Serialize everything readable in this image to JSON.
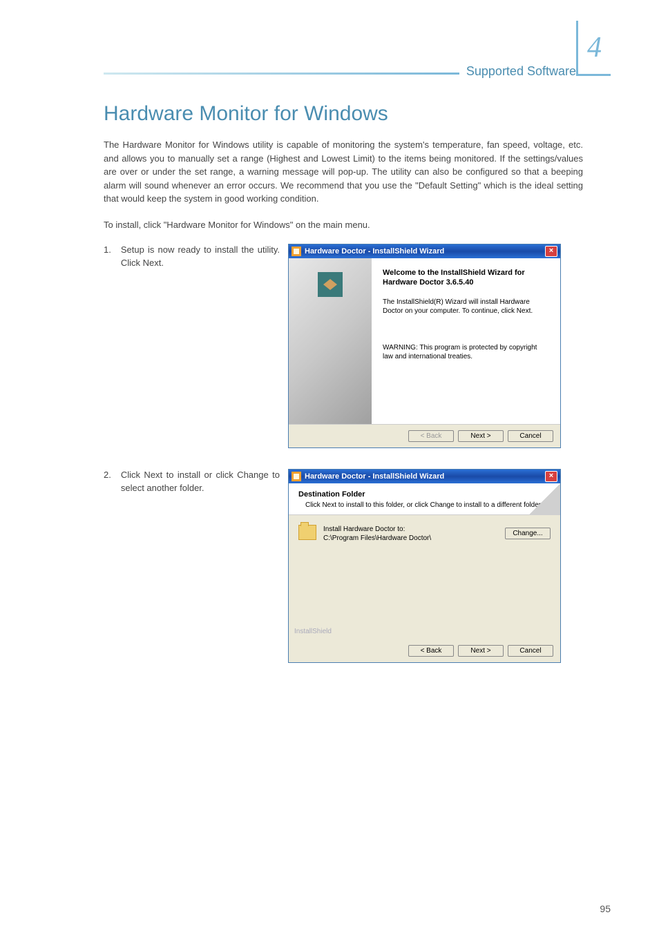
{
  "header": {
    "section_title": "Supported Software",
    "chapter_number": "4"
  },
  "title": "Hardware Monitor for Windows",
  "intro_paragraph": "The Hardware Monitor for Windows utility is capable of monitoring the system's temperature, fan speed, voltage, etc. and allows you to manually set a range (Highest and Lowest Limit) to the items being monitored. If the settings/values are over or under the set range, a warning message will pop-up. The utility can also be configured so that a beeping alarm will sound whenever an error occurs. We recommend that you use the \"Default Setting\" which is the ideal setting that would keep the system in good working condition.",
  "install_note": "To install, click \"Hardware Monitor for Windows\" on the main menu.",
  "steps": [
    {
      "num": "1.",
      "text": "Setup is now ready to install the utility. Click Next."
    },
    {
      "num": "2.",
      "text": "Click Next to install or click Change to select another folder."
    }
  ],
  "dialog1": {
    "title": "Hardware Doctor - InstallShield Wizard",
    "welcome_title": "Welcome to the InstallShield Wizard for Hardware Doctor 3.6.5.40",
    "welcome_para": "The InstallShield(R) Wizard will install Hardware Doctor on your computer. To continue, click Next.",
    "warning": "WARNING: This program is protected by copyright law and international treaties.",
    "back": "< Back",
    "next": "Next >",
    "cancel": "Cancel"
  },
  "dialog2": {
    "title": "Hardware Doctor - InstallShield Wizard",
    "dest_title": "Destination Folder",
    "dest_sub": "Click Next to install to this folder, or click Change to install to a different folder.",
    "install_to": "Install Hardware Doctor to:",
    "path": "C:\\Program Files\\Hardware Doctor\\",
    "change": "Change...",
    "is_label": "InstallShield",
    "back": "< Back",
    "next": "Next >",
    "cancel": "Cancel"
  },
  "page_number": "95"
}
